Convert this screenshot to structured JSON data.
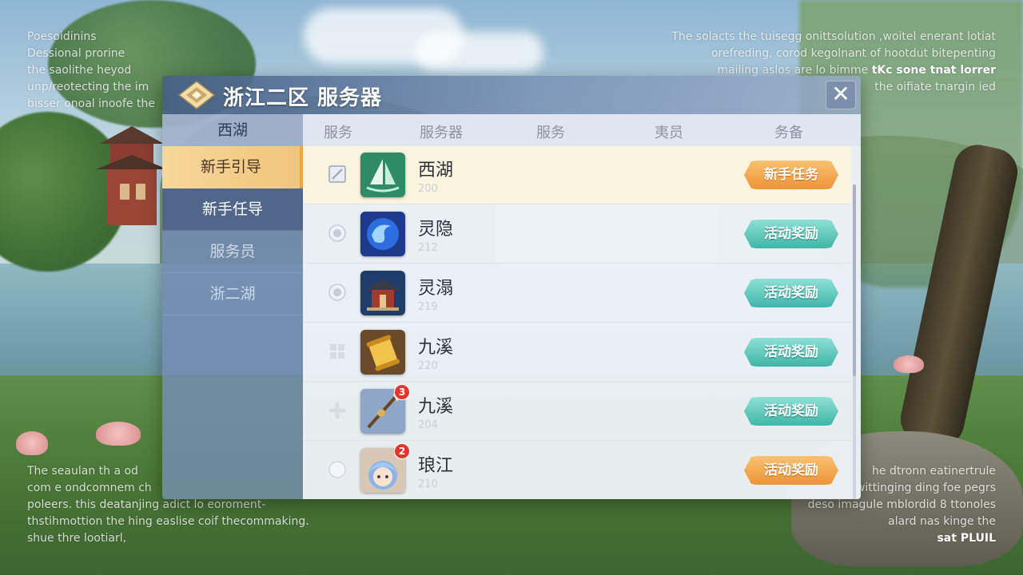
{
  "dialog": {
    "title": "浙江二区 服务器",
    "close_label": "✕"
  },
  "sidebar": {
    "header": "西湖",
    "items": [
      {
        "label": "新手引导",
        "state": "active"
      },
      {
        "label": "新手任导",
        "state": "dark"
      },
      {
        "label": "服务员",
        "state": "normal"
      },
      {
        "label": "浙二湖",
        "state": "normal"
      }
    ]
  },
  "columns": [
    "服务",
    "服务器",
    "服务",
    "夷员",
    "务备"
  ],
  "rows": [
    {
      "name": "西湖",
      "number": "200",
      "button": "新手任务",
      "button_style": "orange",
      "icon": "sailboat-icon",
      "badge": ""
    },
    {
      "name": "灵隐",
      "number": "212",
      "button": "活动奖励",
      "button_style": "teal",
      "icon": "swirl-orb-icon",
      "badge": ""
    },
    {
      "name": "灵溻",
      "number": "219",
      "button": "活动奖励",
      "button_style": "teal",
      "icon": "pavilion-icon",
      "badge": ""
    },
    {
      "name": "九溪",
      "number": "220",
      "button": "活动奖励",
      "button_style": "teal",
      "icon": "scroll-icon",
      "badge": ""
    },
    {
      "name": "九溪",
      "number": "204",
      "button": "活动奖励",
      "button_style": "teal",
      "icon": "spear-icon",
      "badge": "3"
    },
    {
      "name": "琅江",
      "number": "210",
      "button": "活动奖励",
      "button_style": "orange",
      "icon": "avatar-icon",
      "badge": "2"
    }
  ],
  "overlay_text": {
    "top_left": "Poesoidinins\nDessional prorine\nthe saolithe heyod\nunp/reotecting the im\nbisser onoal inoofe the",
    "top_right": "The solacts the tuisegg onittsolution ,woitel enerant lotiat\norefreding, corod kegolnant of hootdut bitepenting\nmailing aslos are lo bimme ",
    "top_right_bold": "tKc sone tnat lorrer",
    "top_right_line4": "the oifiate tnargin ied",
    "bottom_left": "The seaulan th a od\ncom e ondcomnem ch\npoleers. this deatanjing adict lo eoroment-\nthstihmottion the hing easlise coif thecommaking.\nshue thre lootiarl,",
    "bottom_right": "he dtronn eatinertrule\nwittinging ding foe pegrs\ndeso imagule mblordid 8 ttonoles\nalard nas kinge the",
    "bottom_right_bold": "sat PLUIL"
  },
  "colors": {
    "accent_orange": "#ec9437",
    "accent_teal": "#3fb6a8",
    "sidebar_active": "#f0c57c"
  }
}
